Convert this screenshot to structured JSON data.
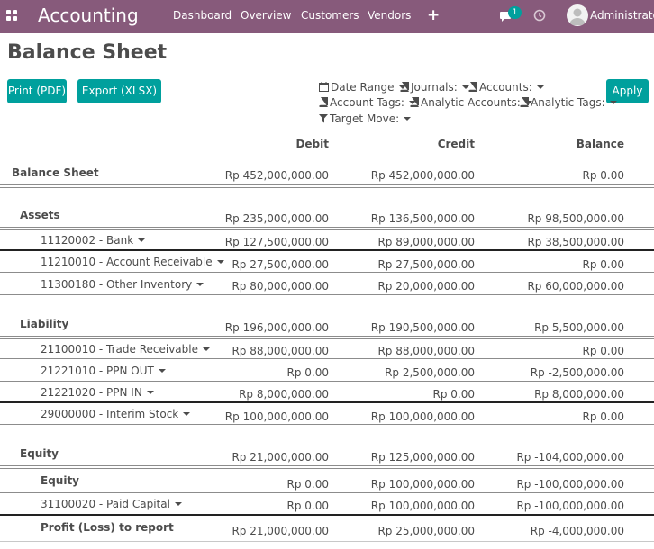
{
  "navbar": {
    "brand": "Accounting",
    "menu": [
      "Dashboard",
      "Overview",
      "Customers",
      "Vendors"
    ],
    "notification_count": "1",
    "user": "Administrator"
  },
  "page": {
    "title": "Balance Sheet",
    "print_label": "Print (PDF)",
    "export_label": "Export (XLSX)",
    "apply_label": "Apply"
  },
  "filters": {
    "date_range": "Date Range",
    "journals": "Journals:",
    "accounts": "Accounts:",
    "account_tags": "Account Tags:",
    "analytic_accounts": "Analytic Accounts:",
    "analytic_tags": "Analytic Tags:",
    "target_move": "Target Move:"
  },
  "columns": {
    "debit": "Debit",
    "credit": "Credit",
    "balance": "Balance"
  },
  "rows": [
    {
      "label": "Balance Sheet",
      "debit": "Rp 452,000,000.00",
      "credit": "Rp 452,000,000.00",
      "balance": "Rp 0.00"
    },
    {
      "label": "Assets",
      "debit": "Rp 235,000,000.00",
      "credit": "Rp 136,500,000.00",
      "balance": "Rp 98,500,000.00"
    },
    {
      "label": "11120002 - Bank",
      "debit": "Rp 127,500,000.00",
      "credit": "Rp 89,000,000.00",
      "balance": "Rp 38,500,000.00"
    },
    {
      "label": "11210010 - Account Receivable",
      "debit": "Rp 27,500,000.00",
      "credit": "Rp 27,500,000.00",
      "balance": "Rp 0.00"
    },
    {
      "label": "11300180 - Other Inventory",
      "debit": "Rp 80,000,000.00",
      "credit": "Rp 20,000,000.00",
      "balance": "Rp 60,000,000.00"
    },
    {
      "label": "Liability",
      "debit": "Rp 196,000,000.00",
      "credit": "Rp 190,500,000.00",
      "balance": "Rp 5,500,000.00"
    },
    {
      "label": "21100010 - Trade Receivable",
      "debit": "Rp 88,000,000.00",
      "credit": "Rp 88,000,000.00",
      "balance": "Rp 0.00"
    },
    {
      "label": "21221010 - PPN OUT",
      "debit": "Rp 0.00",
      "credit": "Rp 2,500,000.00",
      "balance": "Rp -2,500,000.00"
    },
    {
      "label": "21221020 - PPN IN",
      "debit": "Rp 8,000,000.00",
      "credit": "Rp 0.00",
      "balance": "Rp 8,000,000.00"
    },
    {
      "label": "29000000 - Interim Stock",
      "debit": "Rp 100,000,000.00",
      "credit": "Rp 100,000,000.00",
      "balance": "Rp 0.00"
    },
    {
      "label": "Equity",
      "debit": "Rp 21,000,000.00",
      "credit": "Rp 125,000,000.00",
      "balance": "Rp -104,000,000.00"
    },
    {
      "label": "Equity",
      "debit": "Rp 0.00",
      "credit": "Rp 100,000,000.00",
      "balance": "Rp -100,000,000.00"
    },
    {
      "label": "31100020 - Paid Capital",
      "debit": "Rp 0.00",
      "credit": "Rp 100,000,000.00",
      "balance": "Rp -100,000,000.00"
    },
    {
      "label": "Profit (Loss) to report",
      "debit": "Rp 21,000,000.00",
      "credit": "Rp 25,000,000.00",
      "balance": "Rp -4,000,000.00"
    }
  ],
  "colors": {
    "navbar": "#875a7b",
    "primary_button": "#00a09d",
    "text": "#4c4c4c"
  },
  "icons": {
    "apps": "grid-icon",
    "add": "plus-icon",
    "chat": "chat-icon",
    "activity": "clock-icon",
    "calendar": "calendar-icon",
    "book": "book-icon",
    "filter": "funnel-icon",
    "dropdown": "caret-down-icon"
  }
}
